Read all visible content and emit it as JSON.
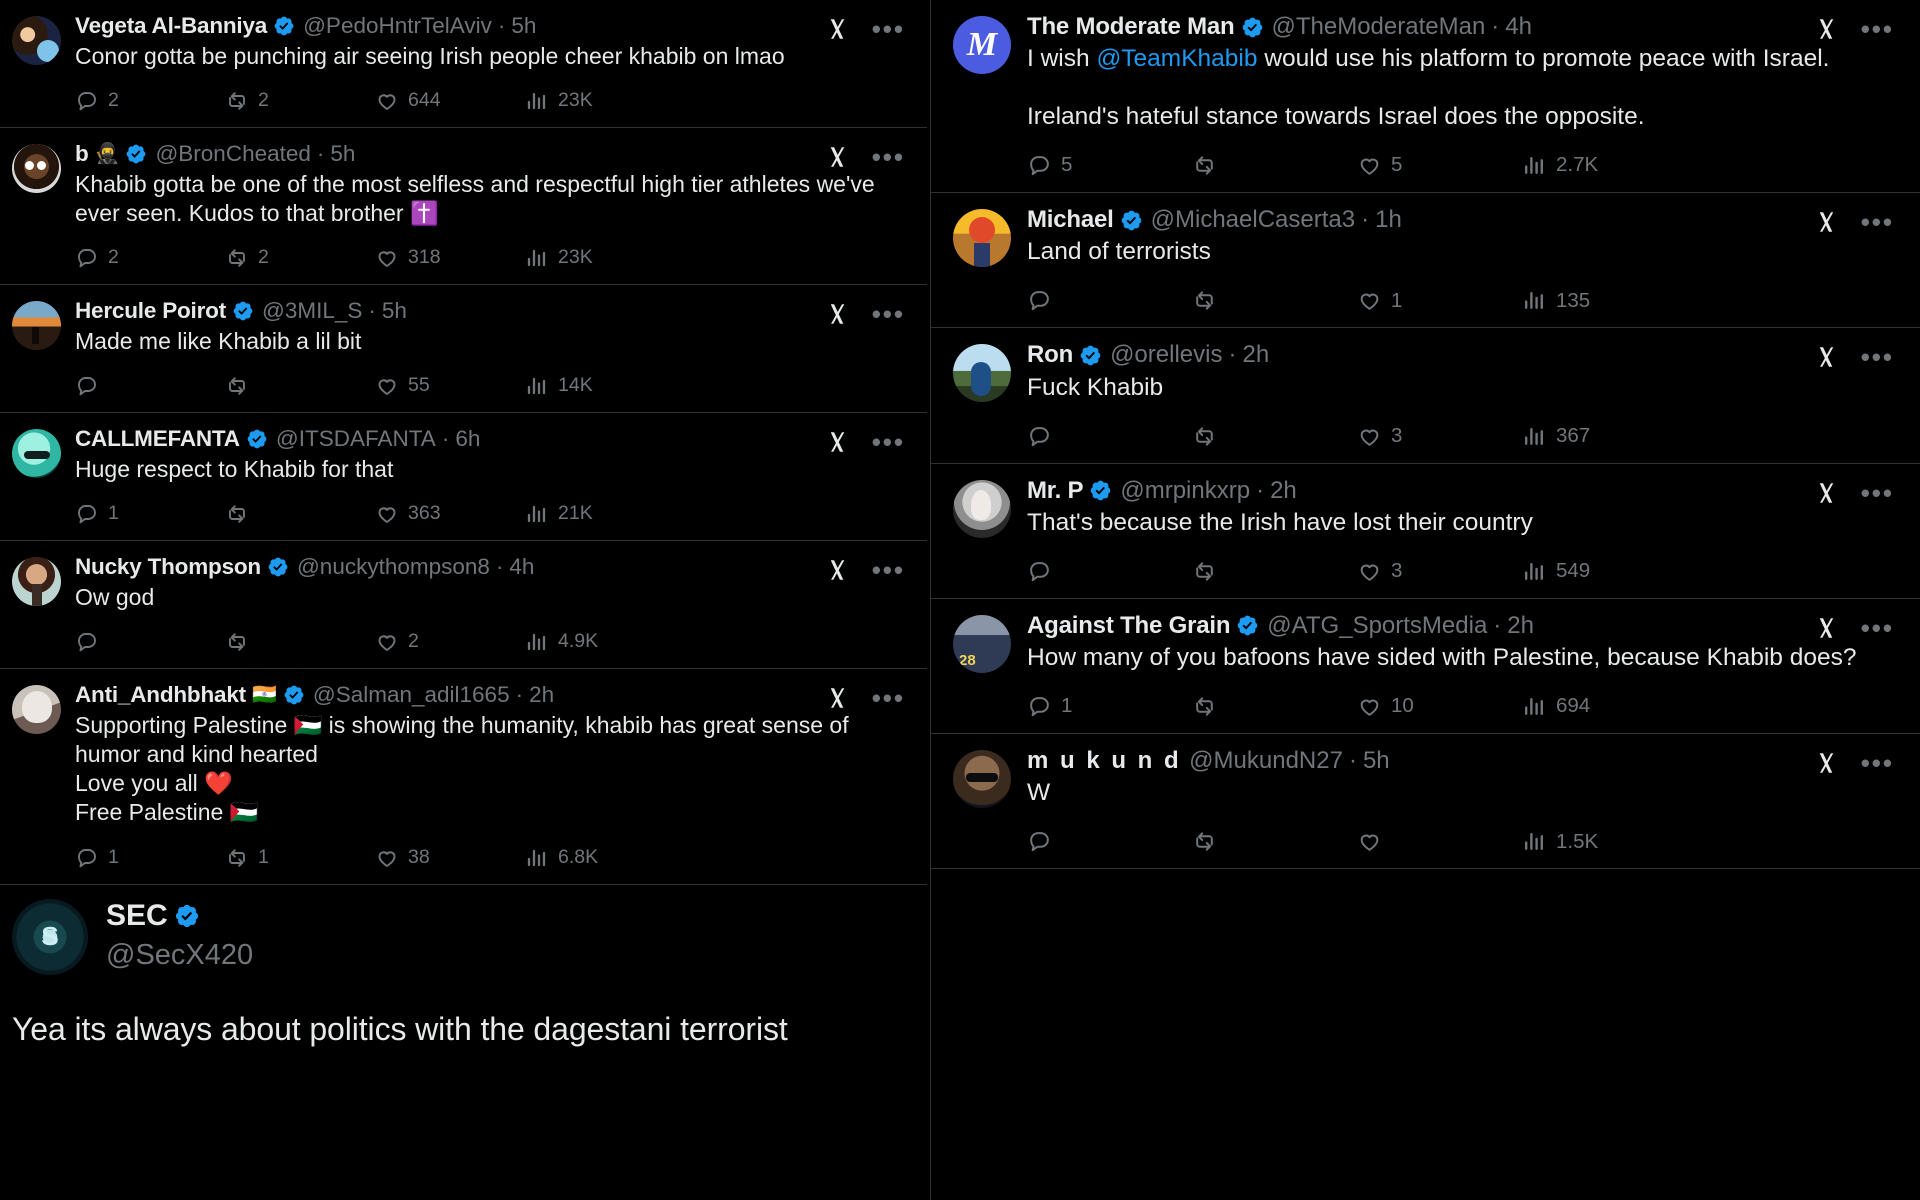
{
  "app": {
    "platform": "X",
    "theme_bg": "#000000",
    "accent": "#1d9bf0",
    "muted": "#71767b",
    "border": "#2f3336"
  },
  "icons": {
    "reply": "reply-icon",
    "retweet": "retweet-icon",
    "like": "like-icon",
    "views": "views-icon",
    "bookmark": "bookmark-icon",
    "share": "share-icon",
    "grok": "grok-icon",
    "more": "more-options-icon",
    "verified": "verified-badge-icon"
  },
  "left_column": {
    "tweets": [
      {
        "name": "Vegeta Al-Banniya",
        "name_emoji": "",
        "verified": true,
        "handle": "@PedoHntrTelAviv",
        "sep": "·",
        "time": "5h",
        "text": "Conor gotta be punching air seeing Irish people cheer khabib on lmao",
        "avatar": "av-vegeta",
        "stats": {
          "replies": "2",
          "retweets": "2",
          "likes": "644",
          "views": "23K"
        }
      },
      {
        "name": "b",
        "name_emoji": "🥷",
        "verified": true,
        "handle": "@BronCheated",
        "sep": "·",
        "time": "5h",
        "text": "Khabib gotta be one of the most selfless and respectful high tier athletes we've ever seen. Kudos to that brother ✝️",
        "avatar": "av-bron",
        "stats": {
          "replies": "2",
          "retweets": "2",
          "likes": "318",
          "views": "23K"
        }
      },
      {
        "name": "Hercule Poirot",
        "name_emoji": "",
        "verified": true,
        "handle": "@3MIL_S",
        "sep": "·",
        "time": "5h",
        "text": "Made me like Khabib a lil bit",
        "avatar": "av-poirot",
        "stats": {
          "replies": "",
          "retweets": "",
          "likes": "55",
          "views": "14K"
        }
      },
      {
        "name": "CALLMEFANTA",
        "name_emoji": "",
        "verified": true,
        "handle": "@ITSDAFANTA",
        "sep": "·",
        "time": "6h",
        "text": "Huge respect to Khabib for that",
        "avatar": "av-fanta",
        "stats": {
          "replies": "1",
          "retweets": "",
          "likes": "363",
          "views": "21K"
        }
      },
      {
        "name": "Nucky Thompson",
        "name_emoji": "",
        "verified": true,
        "handle": "@nuckythompson8",
        "sep": "·",
        "time": "4h",
        "text": "Ow god",
        "avatar": "av-nucky",
        "stats": {
          "replies": "",
          "retweets": "",
          "likes": "2",
          "views": "4.9K"
        }
      },
      {
        "name": "Anti_Andhbhakt",
        "name_emoji": "🇮🇳",
        "verified": true,
        "handle": "@Salman_adil1665",
        "sep": "·",
        "time": "2h",
        "text": "Supporting Palestine 🇵🇸 is showing the humanity, khabib has great sense of humor and kind hearted\nLove you all ❤️\nFree Palestine 🇵🇸",
        "avatar": "av-salman",
        "stats": {
          "replies": "1",
          "retweets": "1",
          "likes": "38",
          "views": "6.8K"
        }
      }
    ],
    "featured_tweet": {
      "name": "SEC",
      "verified": true,
      "handle": "@SecX420",
      "text": "Yea its always about politics with the dagestani terrorist",
      "avatar": "av-sec"
    }
  },
  "right_column": {
    "tweets": [
      {
        "name": "The Moderate Man",
        "name_emoji": "",
        "verified": true,
        "handle": "@TheModerateMan",
        "sep": "·",
        "time": "4h",
        "text_pre": "I wish ",
        "mention": "@TeamKhabib",
        "text_post": " would use his platform to promote peace with Israel.",
        "text_para2": "Ireland's hateful stance towards Israel does the opposite.",
        "avatar": "av-moderate",
        "stats": {
          "replies": "5",
          "retweets": "",
          "likes": "5",
          "views": "2.7K"
        }
      },
      {
        "name": "Michael",
        "name_emoji": "",
        "verified": true,
        "handle": "@MichaelCaserta3",
        "sep": "·",
        "time": "1h",
        "text": "Land of terrorists",
        "avatar": "av-michael",
        "stats": {
          "replies": "",
          "retweets": "",
          "likes": "1",
          "views": "135"
        }
      },
      {
        "name": "Ron",
        "name_emoji": "",
        "verified": true,
        "handle": "@orellevis",
        "sep": "·",
        "time": "2h",
        "text": "Fuck Khabib",
        "avatar": "av-ron",
        "stats": {
          "replies": "",
          "retweets": "",
          "likes": "3",
          "views": "367"
        }
      },
      {
        "name": "Mr. P",
        "name_emoji": "",
        "verified": true,
        "handle": "@mrpinkxrp",
        "sep": "·",
        "time": "2h",
        "text": "That's because the Irish have lost their country",
        "avatar": "av-mrp",
        "stats": {
          "replies": "",
          "retweets": "",
          "likes": "3",
          "views": "549"
        }
      },
      {
        "name": "Against The Grain",
        "name_emoji": "",
        "verified": true,
        "handle": "@ATG_SportsMedia",
        "sep": "·",
        "time": "2h",
        "text": "How many of you bafoons have sided with Palestine, because Khabib does?",
        "avatar": "av-atg",
        "stats": {
          "replies": "1",
          "retweets": "",
          "likes": "10",
          "views": "694"
        }
      },
      {
        "name": "m u k u n d",
        "name_emoji": "",
        "verified": false,
        "handle": "@MukundN27",
        "sep": "·",
        "time": "5h",
        "text": "W",
        "avatar": "av-mukund",
        "stats": {
          "replies": "",
          "retweets": "",
          "likes": "",
          "views": "1.5K"
        }
      }
    ]
  }
}
